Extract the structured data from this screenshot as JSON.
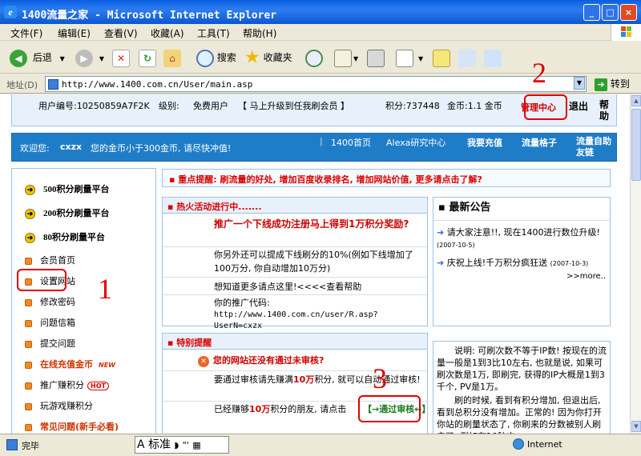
{
  "window": {
    "title": "1400流量之家 - Microsoft Internet Explorer",
    "min_label": "_",
    "max_label": "□",
    "close_label": "×"
  },
  "menu": [
    "文件(F)",
    "编辑(E)",
    "查看(V)",
    "收藏(A)",
    "工具(T)",
    "帮助(H)"
  ],
  "toolbar": {
    "back": "后退",
    "search": "搜索",
    "favorites": "收藏夹"
  },
  "address": {
    "label": "地址(D)",
    "url": "http://www.1400.com.cn/User/main.asp",
    "go": "转到"
  },
  "userbar": {
    "user_id": "用户编号:10250859A7F2K",
    "level_label": "级别:",
    "level_value": "免费用户",
    "upgrade": "【 马上升级到任我刷会员 】",
    "points": "积分:737448",
    "coins": "金币:1.1 金币",
    "admin_center": "管理中心",
    "logout": "退出",
    "help": "帮助"
  },
  "welcome": {
    "greeting": "欢迎您:",
    "username": "cxzx",
    "coin_warning": "您的金币小于300金币, 请尽快冲值!",
    "links": [
      "1400首页",
      "Alexa研究中心",
      "我要充值",
      "流量格子",
      "流量自助友链"
    ]
  },
  "sidebar": {
    "platforms": [
      "500积分刷量平台",
      "200积分刷量平台",
      "80积分刷量平台"
    ],
    "items": [
      {
        "label": "会员首页"
      },
      {
        "label": "设置网站"
      },
      {
        "label": "修改密码"
      },
      {
        "label": "问题信箱"
      },
      {
        "label": "提交问题"
      },
      {
        "label": "在线充值金币",
        "badge": "NEW"
      },
      {
        "label": "推广赚积分",
        "badge": "HOT"
      },
      {
        "label": "玩游戏赚积分"
      },
      {
        "label": "常见问题(新手必看)"
      }
    ]
  },
  "notice": "▪ 重点提醒: 刷流量的好处, 增加百度收录排名, 增加网站价值, 更多请点击了解?",
  "hot": {
    "title": "▪ 热火活动进行中.......",
    "headline": "推广一个下线成功注册马上得到1万积分奖励?",
    "p1": "你另外还可以提成下线刷分的10%(例如下线增加了100万分, 你自动增加10万分)",
    "p2": "想知道更多请点这里!<<<<查看帮助",
    "p3": "你的推广代码:",
    "code": "http://www.1400.com.cn/user/R.asp?UserN=cxzx"
  },
  "bulletin": {
    "title": "▪ 最新公告",
    "items": [
      {
        "text": "请大家注意!!, 现在1400进行数位升级!",
        "date": "(2007-10-5)"
      },
      {
        "text": "庆祝上线!千万积分疯狂送",
        "date": "(2007-10-3)"
      }
    ],
    "more": ">>more.."
  },
  "special": {
    "title": "▪ 特别提醒",
    "alert": "您的网站还没有通过未审核?",
    "p1_a": "要通过审核请先赚满",
    "p1_b": "10万",
    "p1_c": "积分, 就可以自动通过审核!",
    "p2_a": "已经赚够",
    "p2_b": "10万",
    "p2_c": "积分的朋友, 请点击",
    "review_button": "【→通过审核←】"
  },
  "explain": {
    "p1": "说明: 可刷次数不等于IP数! 按现在的流量一般是1到3比10左右, 也就是说, 如果可刷次数是1万, 即刷完, 获得的IP大概是1到3千个, PV是1万。",
    "p2": "刷的时候, 看到有积分增加, 但退出后, 看到总积分没有增加。正常的! 因为你打开你站的刷量状态了, 你刷来的分数被别人刷去了, 例如在10秒内,"
  },
  "annotations": [
    "1",
    "2",
    "3"
  ],
  "status": {
    "text": "完毕",
    "ime": "A 标准",
    "zone": "Internet"
  }
}
